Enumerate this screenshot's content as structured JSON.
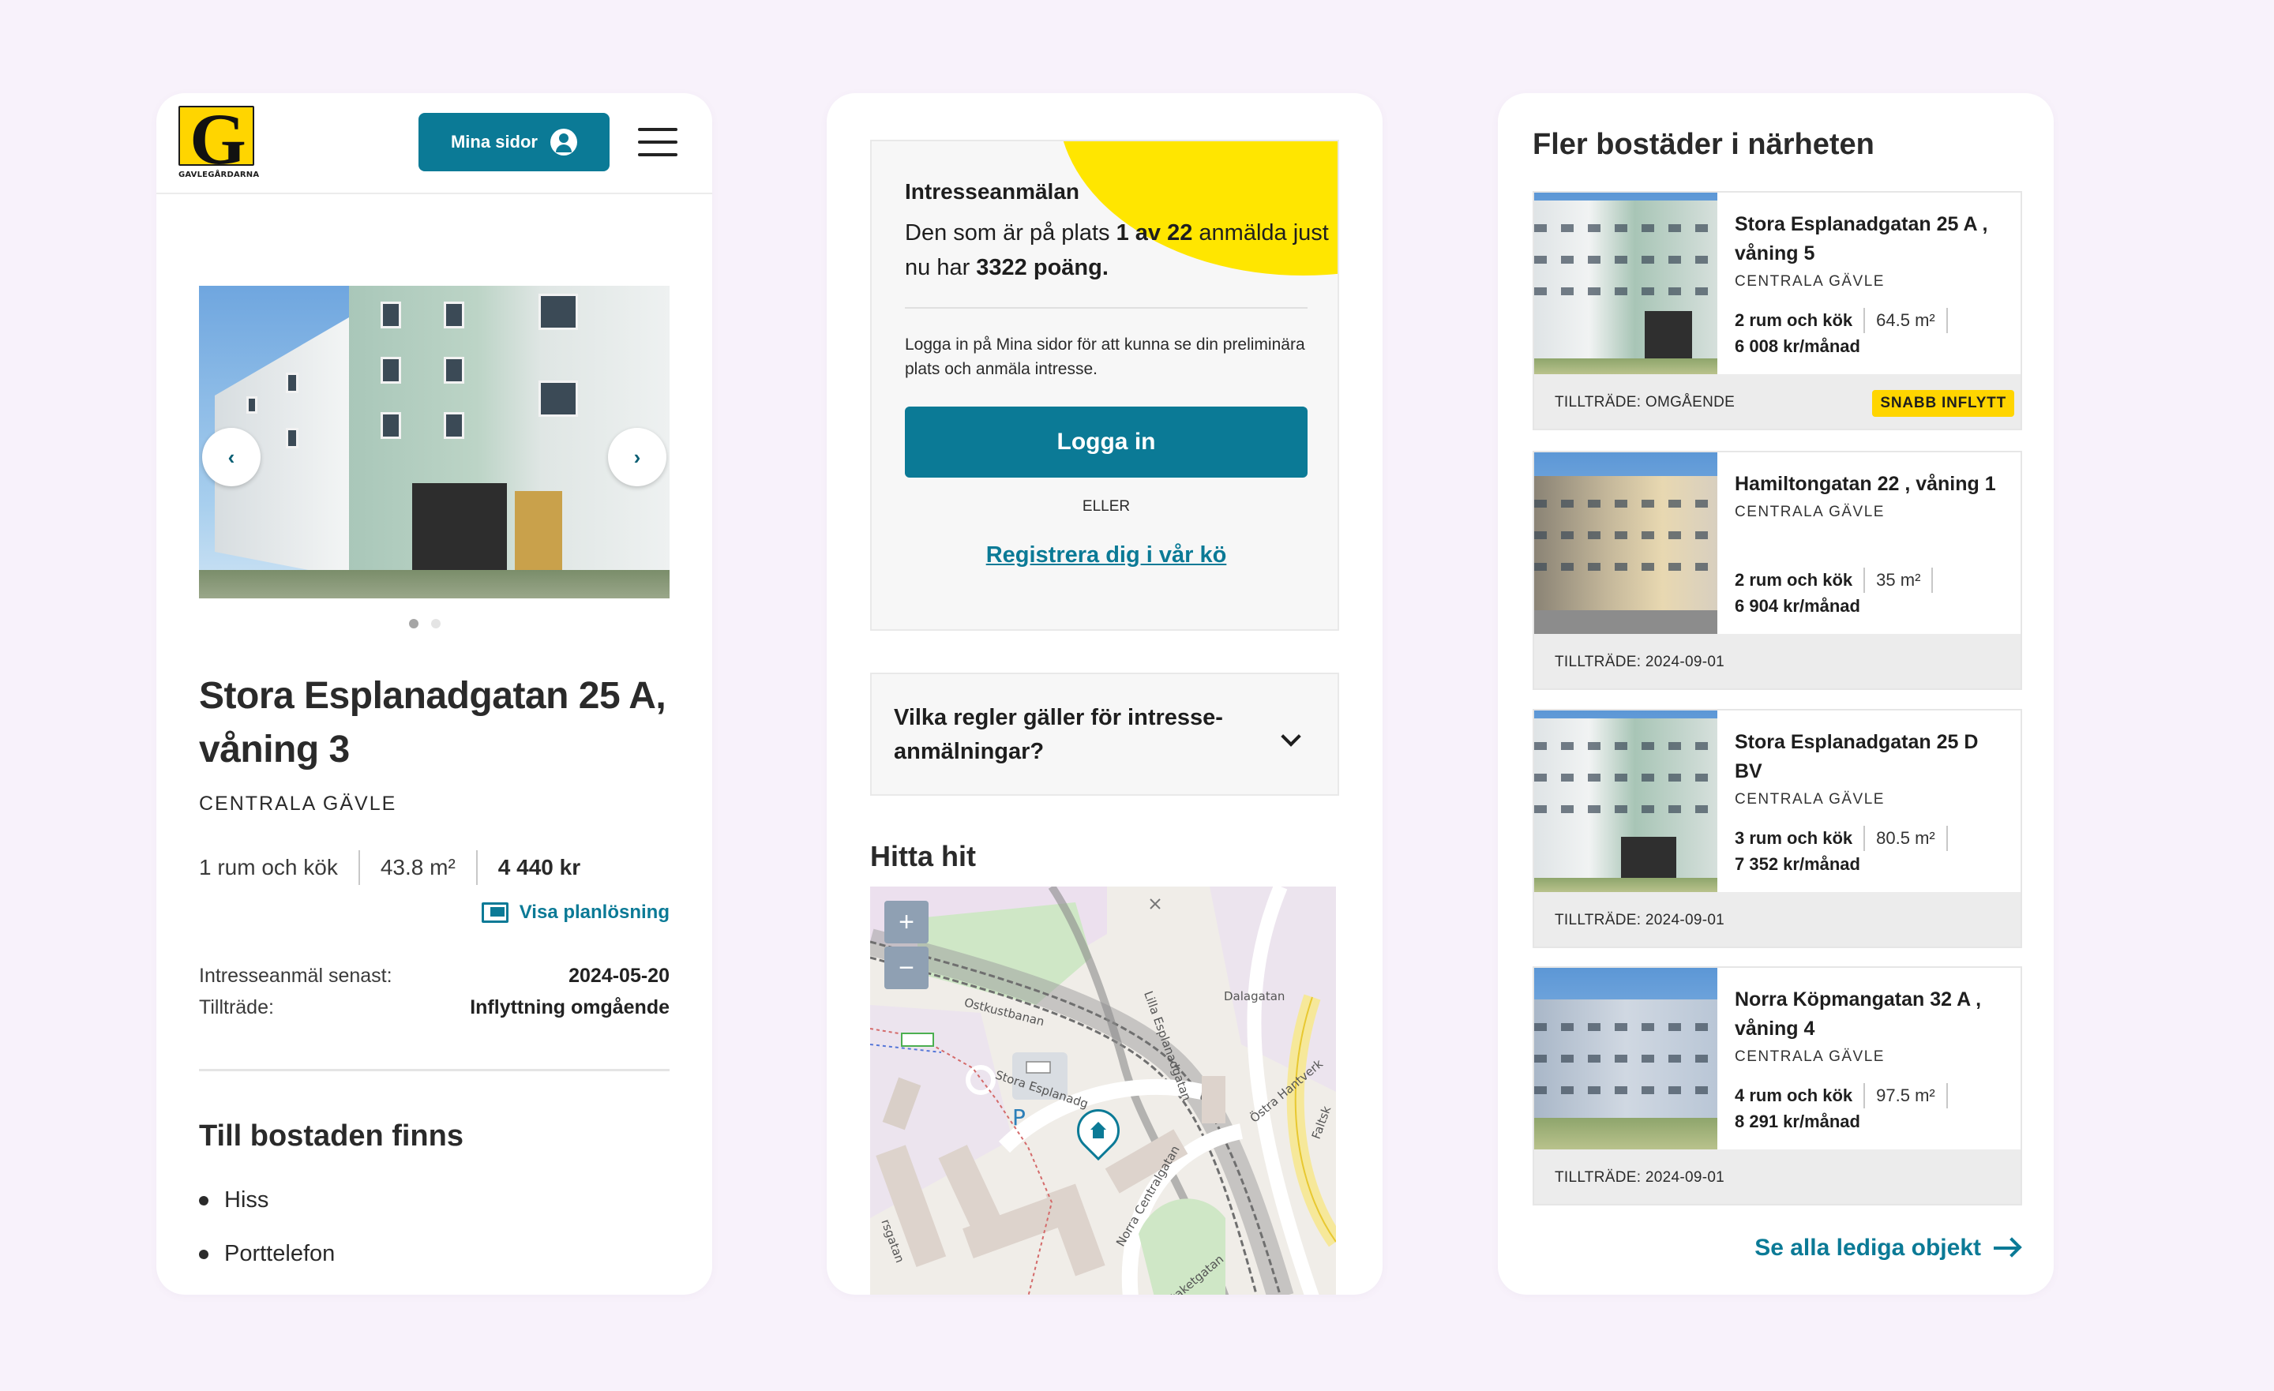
{
  "colors": {
    "background": "#f8f2fb",
    "brand_teal": "#0b7a96",
    "brand_yellow": "#ffd500"
  },
  "header": {
    "logo_text": "GAVLEGÅRDARNA",
    "mina_sidor_label": "Mina sidor",
    "user_icon": "user-circle-icon",
    "menu_icon": "hamburger-menu-icon"
  },
  "property": {
    "carousel": {
      "prev_icon": "chevron-left-icon",
      "next_icon": "chevron-right-icon",
      "slide_count": 2,
      "active_slide": 1
    },
    "title": "Stora Esplanadgatan 25 A, våning 3",
    "district": "CENTRALA GÄVLE",
    "rooms": "1 rum och kök",
    "area": "43.8 m²",
    "rent": "4 440 kr",
    "floorplan_link": "Visa planlösning",
    "interest_deadline_label": "Intresseanmäl senast:",
    "interest_deadline_value": "2024-05-20",
    "access_label": "Tillträde:",
    "access_value": "Inflyttning omgående",
    "amenities_heading": "Till bostaden finns",
    "amenities": [
      "Hiss",
      "Porttelefon"
    ]
  },
  "interest": {
    "title": "Intresseanmälan",
    "queue_text_1": "Den som är på plats ",
    "queue_position": "1 av 22",
    "queue_text_2": " anmälda just nu har ",
    "queue_points": "3322 poäng.",
    "login_text": "Logga in på Mina sidor för att kunna se din preliminära plats och anmäla intresse.",
    "login_button": "Logga in",
    "or_label": "ELLER",
    "register_link": "Registrera dig i vår kö"
  },
  "faq": {
    "question": "Vilka regler gäller för intresse-anmälningar?",
    "toggle_icon": "chevron-down-icon"
  },
  "map": {
    "heading": "Hitta hit",
    "zoom_in": "+",
    "zoom_out": "−",
    "parking_label": "P",
    "marker_icon": "home-marker-icon",
    "street_labels": [
      "Ostkustbanan",
      "Stora Esplanadg",
      "Lilla Esplanadgatan",
      "Dalagatan",
      "Östra Hantverk",
      "Norra Centralgatan",
      "Staketgatan",
      "Faltsk",
      "rsgatan"
    ]
  },
  "nearby": {
    "heading": "Fler bostäder i närheten",
    "listings": [
      {
        "title": "Stora Esplanadgatan 25 A , våning 5",
        "district": "CENTRALA GÄVLE",
        "rooms": "2 rum och kök",
        "area": "64.5 m²",
        "rent": "6 008 kr/månad",
        "access": "TILLTRÄDE: OMGÅENDE",
        "badge": "SNABB INFLYTT"
      },
      {
        "title": "Hamiltongatan 22 , våning 1",
        "district": "CENTRALA GÄVLE",
        "rooms": "2 rum och kök",
        "area": "35 m²",
        "rent": "6 904 kr/månad",
        "access": "TILLTRÄDE: 2024-09-01",
        "badge": ""
      },
      {
        "title": "Stora Esplanadgatan 25 D BV",
        "district": "CENTRALA GÄVLE",
        "rooms": "3 rum och kök",
        "area": "80.5 m²",
        "rent": "7 352 kr/månad",
        "access": "TILLTRÄDE: 2024-09-01",
        "badge": ""
      },
      {
        "title": "Norra Köpmangatan 32 A , våning 4",
        "district": "CENTRALA GÄVLE",
        "rooms": "4 rum och kök",
        "area": "97.5 m²",
        "rent": "8 291 kr/månad",
        "access": "TILLTRÄDE: 2024-09-01",
        "badge": ""
      }
    ],
    "see_all": "Se alla lediga objekt",
    "see_all_icon": "arrow-right-icon"
  }
}
